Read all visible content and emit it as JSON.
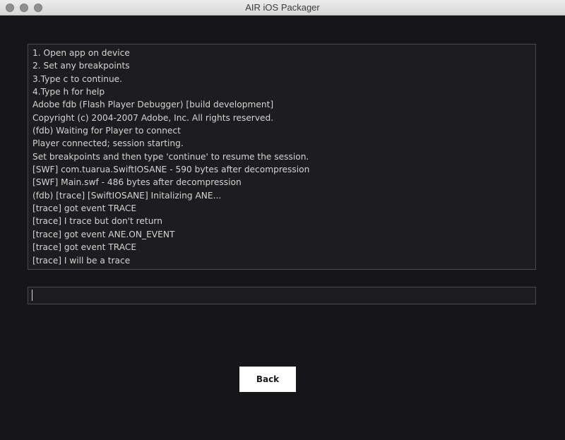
{
  "window": {
    "title": "AIR iOS Packager"
  },
  "console": {
    "lines": [
      "1. Open app on device",
      "2. Set any breakpoints",
      "3.Type c to continue.",
      "4.Type h for help",
      "Adobe fdb (Flash Player Debugger) [build development]",
      "Copyright (c) 2004-2007 Adobe, Inc. All rights reserved.",
      "(fdb) Waiting for Player to connect",
      "Player connected; session starting.",
      "Set breakpoints and then type 'continue' to resume the session.",
      "[SWF] com.tuarua.SwiftIOSANE - 590 bytes after decompression",
      "[SWF] Main.swf - 486 bytes after decompression",
      "(fdb) [trace] [SwiftIOSANE] Initalizing ANE...",
      "[trace] got event TRACE",
      "[trace] I trace but don't return",
      "[trace] got event ANE.ON_EVENT",
      "[trace] got event TRACE",
      "[trace] I will be a trace"
    ]
  },
  "command_input": {
    "value": ""
  },
  "back_button": {
    "label": "Back"
  },
  "colors": {
    "background": "#161619",
    "panel": "#1d1d20",
    "text": "#d4d4d4",
    "button": "#ffffff"
  }
}
